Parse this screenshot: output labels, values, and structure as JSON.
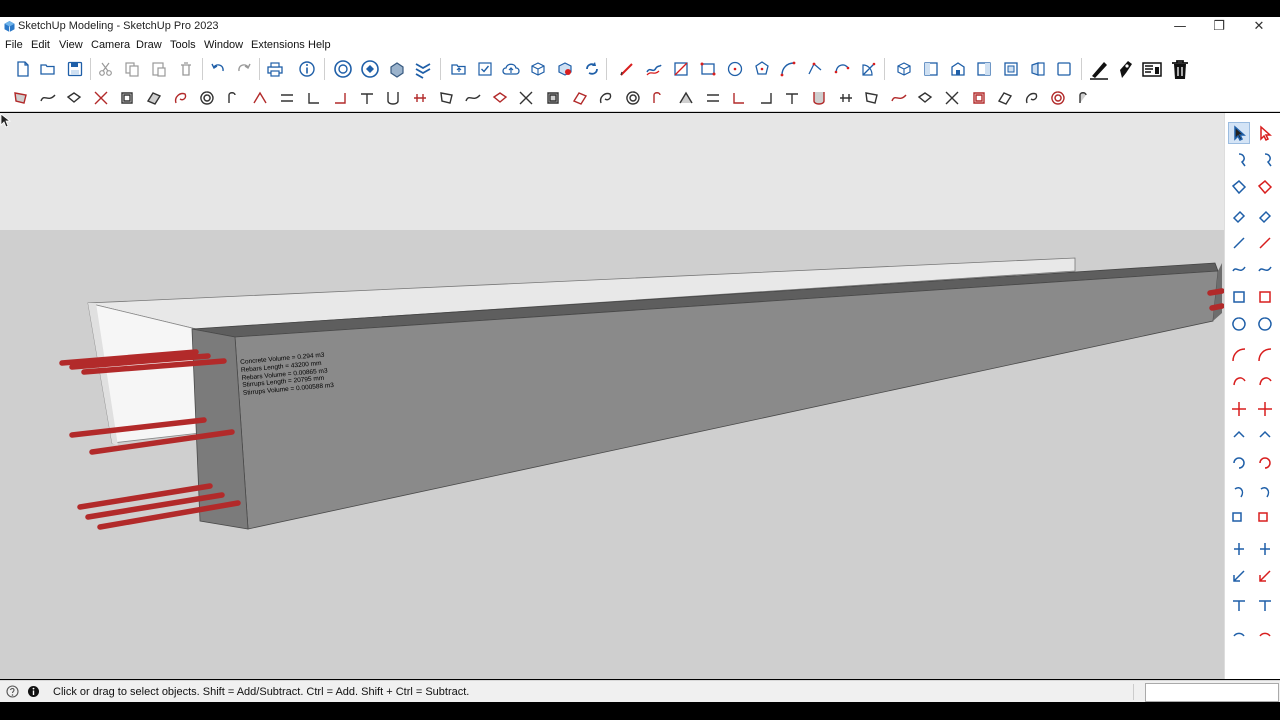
{
  "window": {
    "title": "SketchUp Modeling - SketchUp Pro 2023",
    "minimize_glyph": "—",
    "maximize_glyph": "❐",
    "close_glyph": "✕"
  },
  "menu": {
    "items": [
      "File",
      "Edit",
      "View",
      "Camera",
      "Draw",
      "Tools",
      "Window",
      "Extensions",
      "Help"
    ]
  },
  "model": {
    "label_lines": [
      "Concrete Volume = 0.294 m3",
      "Rebars Length = 43200 mm",
      "Rebars Volume = 0.00865 m3",
      "Stirrups Length = 20795 mm",
      "Stirrups Volume = 0.000588 m3"
    ]
  },
  "statusbar": {
    "hint": "Click or drag to select objects. Shift = Add/Subtract. Ctrl = Add. Shift + Ctrl = Subtract.",
    "measurements_value": ""
  },
  "colors": {
    "sky": "#e6e6e6",
    "ground": "#cfcfcf",
    "beam_front": "#8a8a8a",
    "beam_top": "#6a6a6a",
    "rebar": "#b22a2a",
    "accent_red": "#d81e1e",
    "accent_blue": "#1f5fa8"
  }
}
